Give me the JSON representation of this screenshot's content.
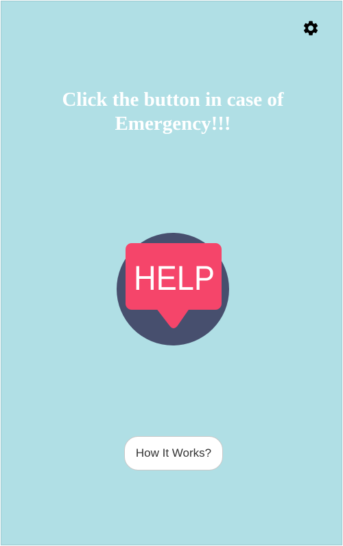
{
  "header": {
    "settings_icon": "gear-icon"
  },
  "main": {
    "headline": "Click the button in case of Emergency!!!",
    "help_button": {
      "label": "HELP",
      "icon": "help-speech-bubble-icon"
    },
    "how_it_works_label": "How It Works?"
  },
  "colors": {
    "background": "#b0dfe5",
    "headline_text": "#ffffff",
    "help_circle": "#474f6e",
    "help_bubble": "#f5456a",
    "help_text": "#ffffff",
    "secondary_button_bg": "#ffffff"
  }
}
